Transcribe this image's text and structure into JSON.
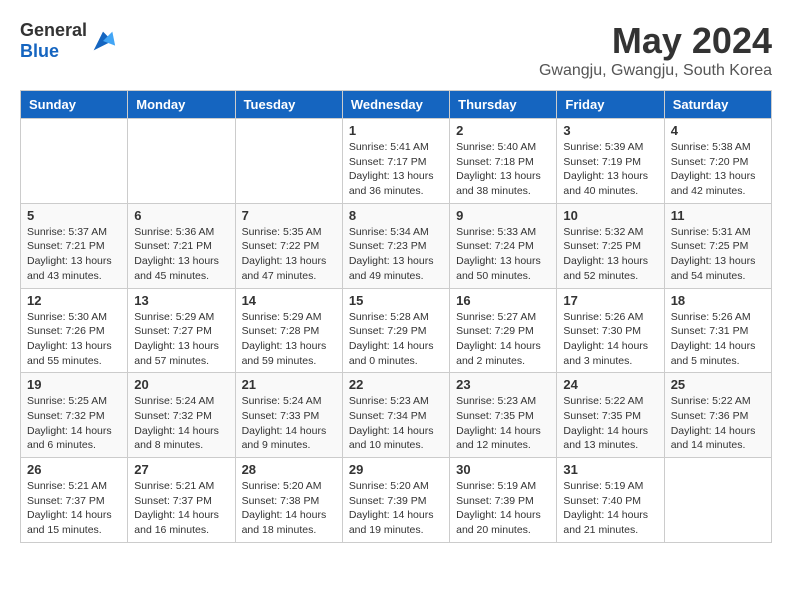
{
  "header": {
    "logo_general": "General",
    "logo_blue": "Blue",
    "title": "May 2024",
    "subtitle": "Gwangju, Gwangju, South Korea"
  },
  "days_of_week": [
    "Sunday",
    "Monday",
    "Tuesday",
    "Wednesday",
    "Thursday",
    "Friday",
    "Saturday"
  ],
  "weeks": [
    [
      {
        "day": "",
        "info": ""
      },
      {
        "day": "",
        "info": ""
      },
      {
        "day": "",
        "info": ""
      },
      {
        "day": "1",
        "info": "Sunrise: 5:41 AM\nSunset: 7:17 PM\nDaylight: 13 hours\nand 36 minutes."
      },
      {
        "day": "2",
        "info": "Sunrise: 5:40 AM\nSunset: 7:18 PM\nDaylight: 13 hours\nand 38 minutes."
      },
      {
        "day": "3",
        "info": "Sunrise: 5:39 AM\nSunset: 7:19 PM\nDaylight: 13 hours\nand 40 minutes."
      },
      {
        "day": "4",
        "info": "Sunrise: 5:38 AM\nSunset: 7:20 PM\nDaylight: 13 hours\nand 42 minutes."
      }
    ],
    [
      {
        "day": "5",
        "info": "Sunrise: 5:37 AM\nSunset: 7:21 PM\nDaylight: 13 hours\nand 43 minutes."
      },
      {
        "day": "6",
        "info": "Sunrise: 5:36 AM\nSunset: 7:21 PM\nDaylight: 13 hours\nand 45 minutes."
      },
      {
        "day": "7",
        "info": "Sunrise: 5:35 AM\nSunset: 7:22 PM\nDaylight: 13 hours\nand 47 minutes."
      },
      {
        "day": "8",
        "info": "Sunrise: 5:34 AM\nSunset: 7:23 PM\nDaylight: 13 hours\nand 49 minutes."
      },
      {
        "day": "9",
        "info": "Sunrise: 5:33 AM\nSunset: 7:24 PM\nDaylight: 13 hours\nand 50 minutes."
      },
      {
        "day": "10",
        "info": "Sunrise: 5:32 AM\nSunset: 7:25 PM\nDaylight: 13 hours\nand 52 minutes."
      },
      {
        "day": "11",
        "info": "Sunrise: 5:31 AM\nSunset: 7:25 PM\nDaylight: 13 hours\nand 54 minutes."
      }
    ],
    [
      {
        "day": "12",
        "info": "Sunrise: 5:30 AM\nSunset: 7:26 PM\nDaylight: 13 hours\nand 55 minutes."
      },
      {
        "day": "13",
        "info": "Sunrise: 5:29 AM\nSunset: 7:27 PM\nDaylight: 13 hours\nand 57 minutes."
      },
      {
        "day": "14",
        "info": "Sunrise: 5:29 AM\nSunset: 7:28 PM\nDaylight: 13 hours\nand 59 minutes."
      },
      {
        "day": "15",
        "info": "Sunrise: 5:28 AM\nSunset: 7:29 PM\nDaylight: 14 hours\nand 0 minutes."
      },
      {
        "day": "16",
        "info": "Sunrise: 5:27 AM\nSunset: 7:29 PM\nDaylight: 14 hours\nand 2 minutes."
      },
      {
        "day": "17",
        "info": "Sunrise: 5:26 AM\nSunset: 7:30 PM\nDaylight: 14 hours\nand 3 minutes."
      },
      {
        "day": "18",
        "info": "Sunrise: 5:26 AM\nSunset: 7:31 PM\nDaylight: 14 hours\nand 5 minutes."
      }
    ],
    [
      {
        "day": "19",
        "info": "Sunrise: 5:25 AM\nSunset: 7:32 PM\nDaylight: 14 hours\nand 6 minutes."
      },
      {
        "day": "20",
        "info": "Sunrise: 5:24 AM\nSunset: 7:32 PM\nDaylight: 14 hours\nand 8 minutes."
      },
      {
        "day": "21",
        "info": "Sunrise: 5:24 AM\nSunset: 7:33 PM\nDaylight: 14 hours\nand 9 minutes."
      },
      {
        "day": "22",
        "info": "Sunrise: 5:23 AM\nSunset: 7:34 PM\nDaylight: 14 hours\nand 10 minutes."
      },
      {
        "day": "23",
        "info": "Sunrise: 5:23 AM\nSunset: 7:35 PM\nDaylight: 14 hours\nand 12 minutes."
      },
      {
        "day": "24",
        "info": "Sunrise: 5:22 AM\nSunset: 7:35 PM\nDaylight: 14 hours\nand 13 minutes."
      },
      {
        "day": "25",
        "info": "Sunrise: 5:22 AM\nSunset: 7:36 PM\nDaylight: 14 hours\nand 14 minutes."
      }
    ],
    [
      {
        "day": "26",
        "info": "Sunrise: 5:21 AM\nSunset: 7:37 PM\nDaylight: 14 hours\nand 15 minutes."
      },
      {
        "day": "27",
        "info": "Sunrise: 5:21 AM\nSunset: 7:37 PM\nDaylight: 14 hours\nand 16 minutes."
      },
      {
        "day": "28",
        "info": "Sunrise: 5:20 AM\nSunset: 7:38 PM\nDaylight: 14 hours\nand 18 minutes."
      },
      {
        "day": "29",
        "info": "Sunrise: 5:20 AM\nSunset: 7:39 PM\nDaylight: 14 hours\nand 19 minutes."
      },
      {
        "day": "30",
        "info": "Sunrise: 5:19 AM\nSunset: 7:39 PM\nDaylight: 14 hours\nand 20 minutes."
      },
      {
        "day": "31",
        "info": "Sunrise: 5:19 AM\nSunset: 7:40 PM\nDaylight: 14 hours\nand 21 minutes."
      },
      {
        "day": "",
        "info": ""
      }
    ]
  ]
}
